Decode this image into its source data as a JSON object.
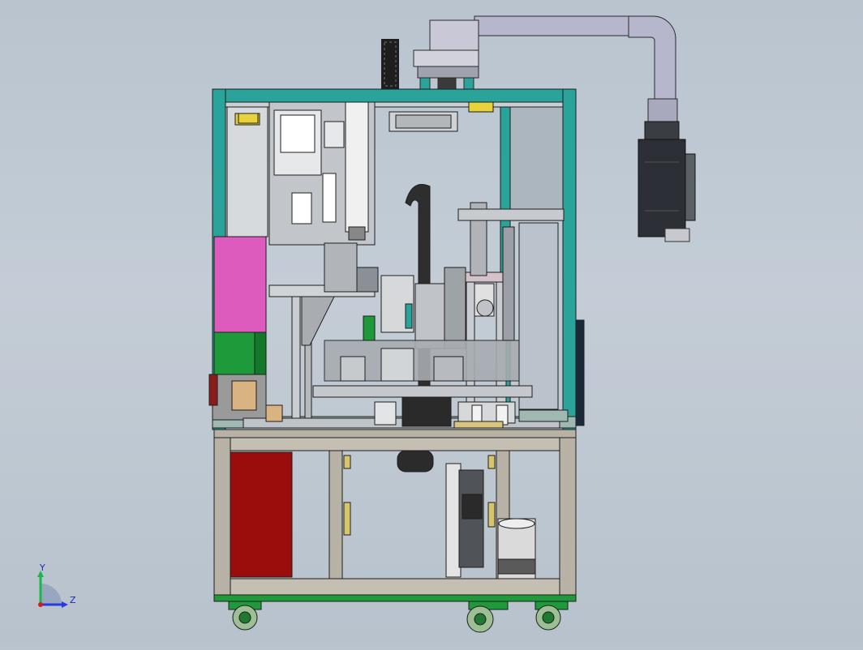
{
  "viewport": {
    "background_top": "#b9c4cf",
    "background_bottom": "#b8c2cc"
  },
  "colors": {
    "frame_teal": "#2aa39a",
    "frame_grey": "#b7b1a6",
    "panel_pink": "#dd5bbd",
    "panel_green": "#1f9a3a",
    "panel_red": "#9b0d0d",
    "pipe": "#b6b6cc",
    "motor": "#2c2f35",
    "outline": "#2a2a2a"
  },
  "triad": {
    "x_label": "Y",
    "z_label": "Z",
    "y_color": "#1db64b",
    "z_color": "#2b3adf",
    "x_color": "#d11d1d"
  },
  "icons": {
    "triad_icon": "coordinate-triad-icon",
    "caster_icon": "caster-wheel-icon",
    "motor_icon": "servo-motor-icon"
  }
}
